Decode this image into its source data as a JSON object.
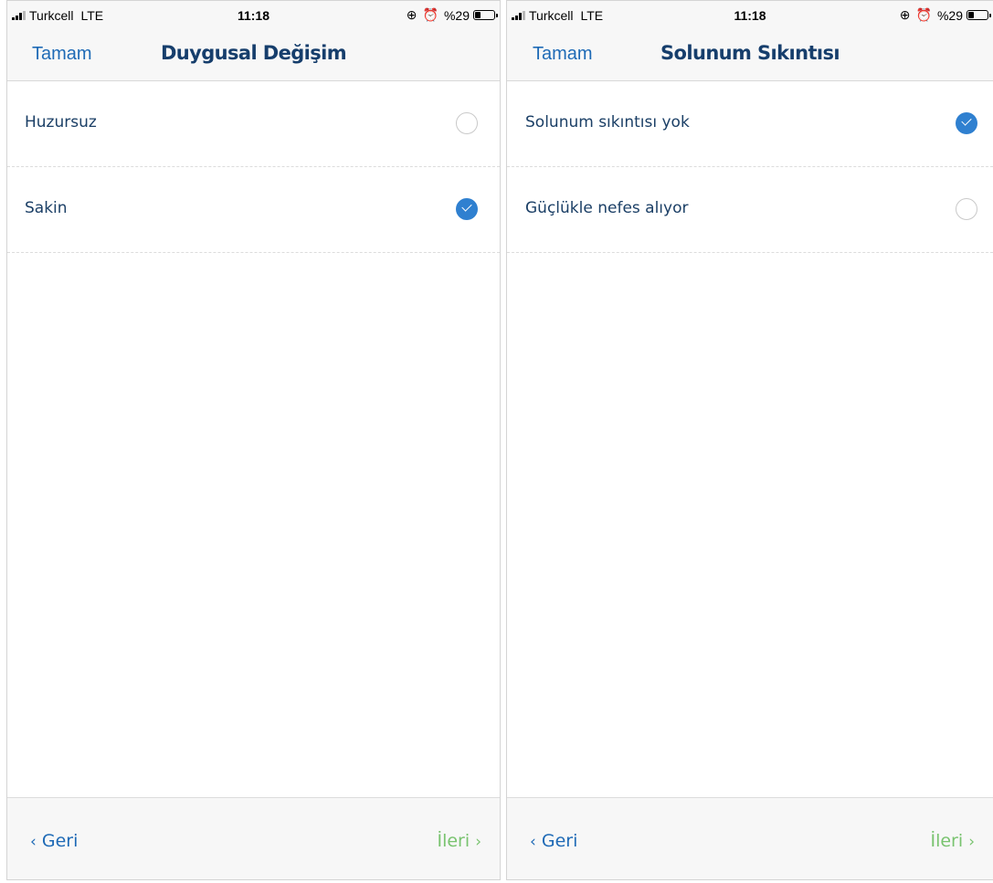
{
  "screens": [
    {
      "status": {
        "carrier": "Turkcell",
        "network": "LTE",
        "time": "11:18",
        "battery": "%29",
        "battery_level": 0.29,
        "icons": [
          "orientation-lock-icon",
          "alarm-icon"
        ]
      },
      "nav": {
        "done_label": "Tamam",
        "title": "Duygusal Değişim"
      },
      "options": [
        {
          "label": "Huzursuz",
          "selected": false
        },
        {
          "label": "Sakin",
          "selected": true
        }
      ],
      "footer": {
        "back_label": "Geri",
        "next_label": "İleri"
      }
    },
    {
      "status": {
        "carrier": "Turkcell",
        "network": "LTE",
        "time": "11:18",
        "battery": "%29",
        "battery_level": 0.29,
        "icons": [
          "orientation-lock-icon",
          "alarm-icon"
        ]
      },
      "nav": {
        "done_label": "Tamam",
        "title": "Solunum Sıkıntısı"
      },
      "options": [
        {
          "label": "Solunum sıkıntısı yok",
          "selected": true
        },
        {
          "label": "Güçlükle nefes alıyor",
          "selected": false
        }
      ],
      "footer": {
        "back_label": "Geri",
        "next_label": "İleri"
      }
    }
  ],
  "colors": {
    "accent": "#1e6ab6",
    "title": "#163e6c",
    "next": "#79c36f",
    "check": "#2f80d0"
  }
}
